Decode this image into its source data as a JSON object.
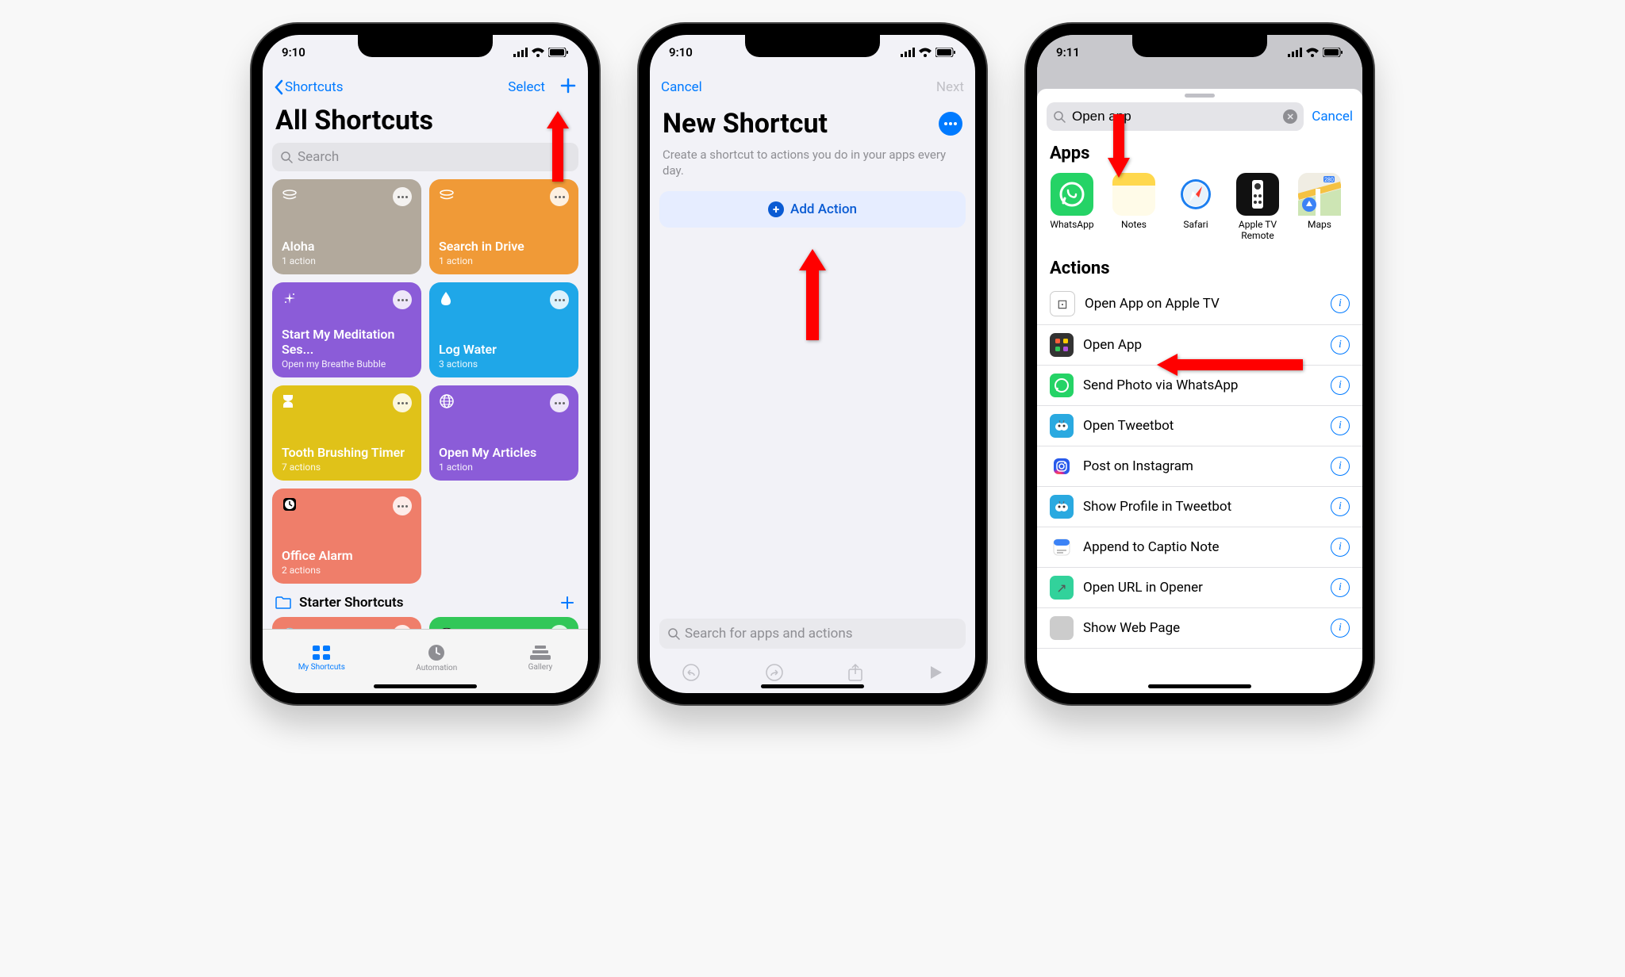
{
  "statusbar": {
    "time_1": "9:10",
    "time_2": "9:10",
    "time_3": "9:11"
  },
  "phone1": {
    "back_label": "Shortcuts",
    "select_label": "Select",
    "title": "All Shortcuts",
    "search_placeholder": "Search",
    "cards": [
      {
        "title": "Aloha",
        "sub": "1 action",
        "color": "#b2a99c",
        "icon": "layers"
      },
      {
        "title": "Search in Drive",
        "sub": "1 action",
        "color": "#f09a37",
        "icon": "layers"
      },
      {
        "title": "Start My Meditation Ses...",
        "sub": "Open my Breathe Bubble",
        "color": "#8b5cd8",
        "icon": "sparkle"
      },
      {
        "title": "Log Water",
        "sub": "3 actions",
        "color": "#1fa7e8",
        "icon": "drop"
      },
      {
        "title": "Tooth Brushing Timer",
        "sub": "7 actions",
        "color": "#e0c219",
        "icon": "hourglass"
      },
      {
        "title": "Open My Articles",
        "sub": "1 action",
        "color": "#8b5cd8",
        "icon": "globe"
      },
      {
        "title": "Office Alarm",
        "sub": "2 actions",
        "color": "#ef7e6a",
        "icon": "clock"
      }
    ],
    "section": "Starter Shortcuts",
    "tabs": [
      {
        "label": "My Shortcuts",
        "active": true
      },
      {
        "label": "Automation",
        "active": false
      },
      {
        "label": "Gallery",
        "active": false
      }
    ]
  },
  "phone2": {
    "cancel": "Cancel",
    "next": "Next",
    "title": "New Shortcut",
    "description": "Create a shortcut to actions you do in your apps every day.",
    "add_action": "Add Action",
    "search_placeholder": "Search for apps and actions"
  },
  "phone3": {
    "search_value": "Open app",
    "cancel": "Cancel",
    "apps_header": "Apps",
    "apps": [
      {
        "name": "WhatsApp",
        "bg": "#25d366",
        "glyph": "wa"
      },
      {
        "name": "Notes",
        "bg": "linear-gradient(#ffd84d 0 30%, #fffbe8 30% 100%)",
        "glyph": ""
      },
      {
        "name": "Safari",
        "bg": "#fff",
        "glyph": "safari"
      },
      {
        "name": "Apple TV Remote",
        "bg": "#111",
        "glyph": "remote"
      },
      {
        "name": "Maps",
        "bg": "#f4f2ec",
        "glyph": "maps"
      }
    ],
    "actions_header": "Actions",
    "actions": [
      {
        "label": "Open App on Apple TV",
        "icon_bg": "#fff",
        "icon_glyph": "⊡",
        "icon_border": true
      },
      {
        "label": "Open App",
        "icon_bg": "#333",
        "icon_glyph": "grid"
      },
      {
        "label": "Send Photo via WhatsApp",
        "icon_bg": "#25d366",
        "icon_glyph": "wa"
      },
      {
        "label": "Open Tweetbot",
        "icon_bg": "#2aa9e0",
        "icon_glyph": "bird"
      },
      {
        "label": "Post on Instagram",
        "icon_bg": "#fff",
        "icon_glyph": "ig"
      },
      {
        "label": "Show Profile in Tweetbot",
        "icon_bg": "#2aa9e0",
        "icon_glyph": "bird"
      },
      {
        "label": "Append to Captio Note",
        "icon_bg": "#fff",
        "icon_glyph": "note"
      },
      {
        "label": "Open URL in Opener",
        "icon_bg": "#32d29b",
        "icon_glyph": "↗"
      },
      {
        "label": "Show Web Page",
        "icon_bg": "#ccc",
        "icon_glyph": ""
      }
    ]
  }
}
